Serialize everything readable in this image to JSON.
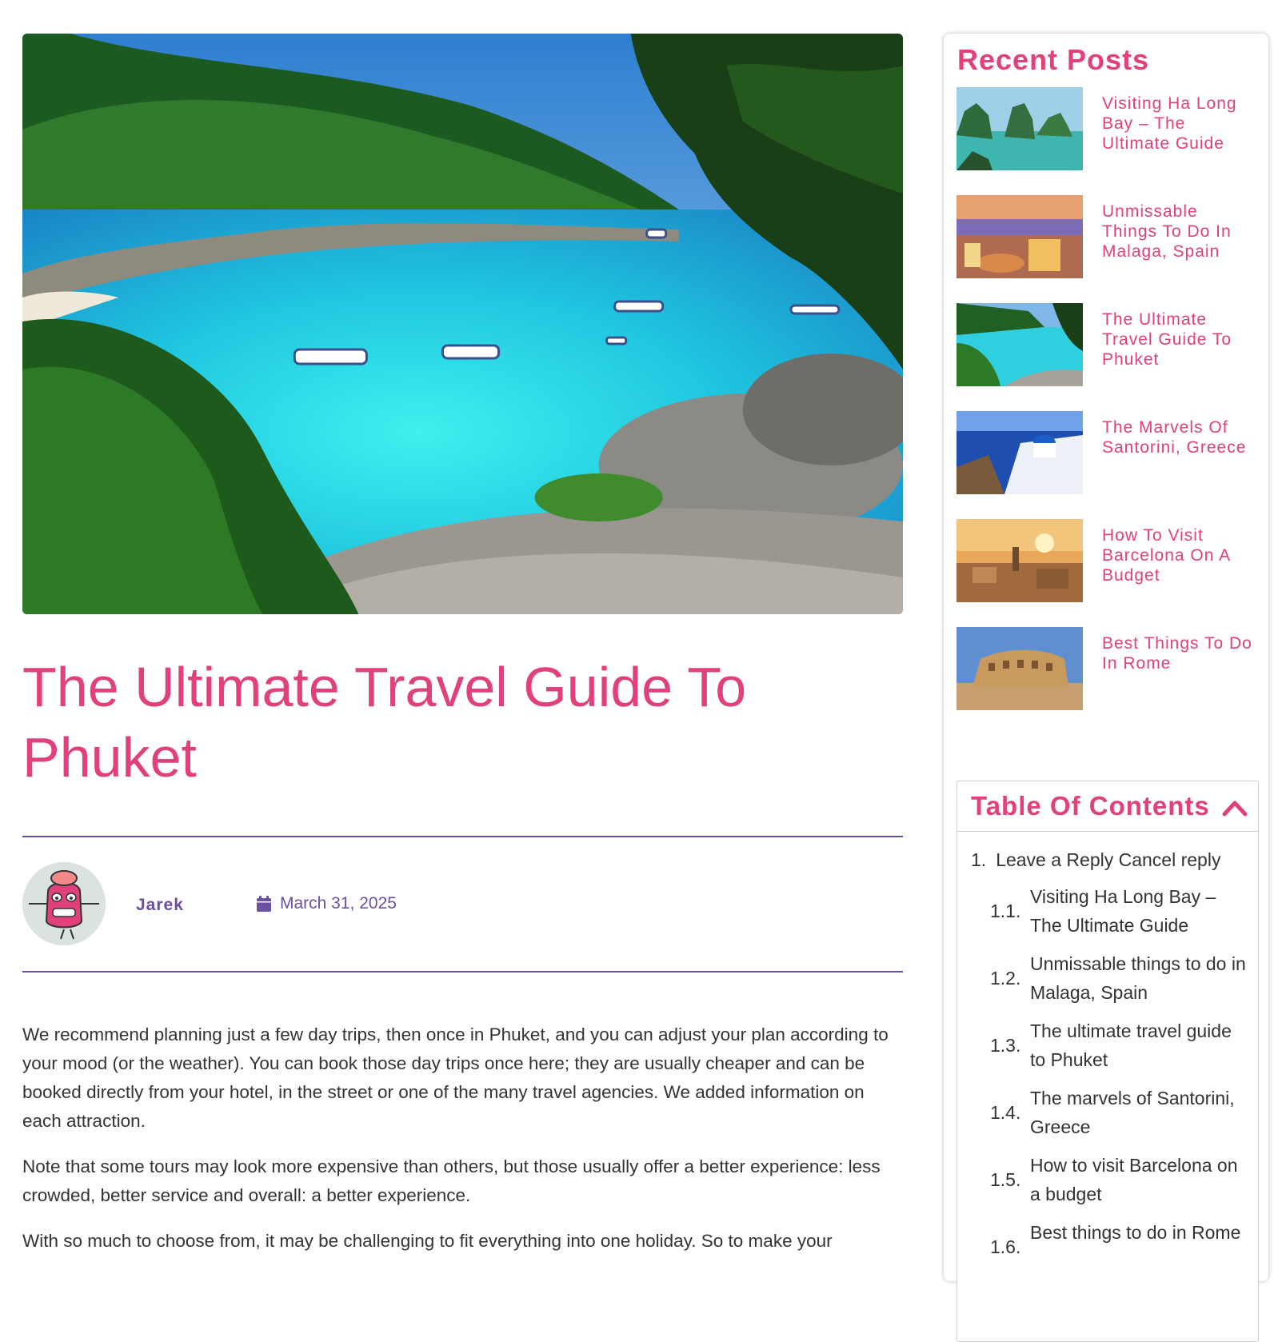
{
  "post": {
    "title": "The Ultimate Travel Guide To Phuket",
    "author": "Jarek",
    "date": "March 31, 2025",
    "paragraphs": [
      "We recommend planning just a few day trips, then once in Phuket, and you can adjust your plan according to your mood (or the weather). You can book those day trips once here; they are usually cheaper and can be booked directly from your hotel, in the street or one of the many travel agencies. We added information on each attraction.",
      "Note that some tours may look more expensive than others, but those usually offer a better experience: less crowded, better service and overall: a better experience.",
      "With so much to choose from, it may be challenging to fit everything into one holiday. So to make your"
    ]
  },
  "sidebar": {
    "recent_heading": "Recent Posts",
    "recent_posts": [
      {
        "title": "Visiting Ha Long Bay – The Ultimate Guide"
      },
      {
        "title": "Unmissable Things To Do In Malaga, Spain"
      },
      {
        "title": "The Ultimate Travel Guide To Phuket"
      },
      {
        "title": "The Marvels Of Santorini, Greece"
      },
      {
        "title": "How To Visit Barcelona On A Budget"
      },
      {
        "title": "Best Things To Do In Rome"
      }
    ],
    "toc": {
      "title": "Table Of Contents",
      "toggle_icon": "chevron-up-icon",
      "item": {
        "num": "1.",
        "text": "Leave a Reply Cancel reply"
      },
      "subitems": [
        {
          "num": "1.1.",
          "text": "Visiting Ha Long Bay – The Ultimate Guide"
        },
        {
          "num": "1.2.",
          "text": "Unmissable things to do in Malaga, Spain"
        },
        {
          "num": "1.3.",
          "text": "The ultimate travel guide to Phuket"
        },
        {
          "num": "1.4.",
          "text": "The marvels of Santorini, Greece"
        },
        {
          "num": "1.5.",
          "text": "How to visit Barcelona on a budget"
        },
        {
          "num": "1.6.",
          "text": "Best things to do in Rome"
        }
      ]
    }
  },
  "colors": {
    "accent_pink": "#e0407c",
    "accent_purple": "#6b4fa1",
    "body_text": "#333333"
  }
}
